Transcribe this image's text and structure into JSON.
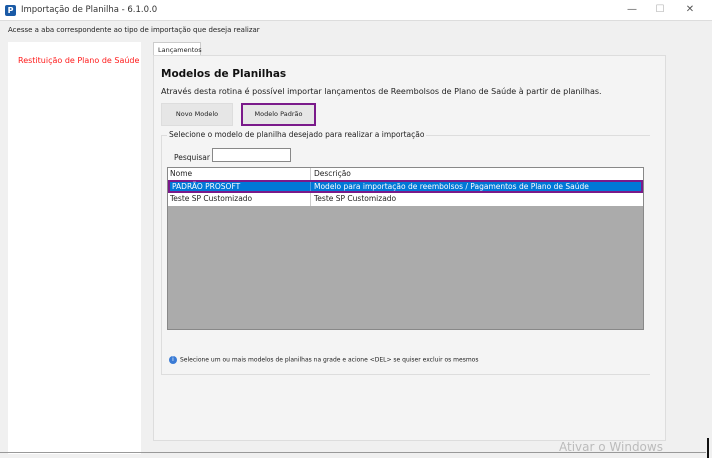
{
  "window": {
    "title": "Importação de Planilha - 6.1.0.0",
    "app_icon": "P",
    "minimize": "—",
    "maximize": "☐",
    "close": "✕"
  },
  "hint": "Acesse a aba correspondente ao tipo de importação que deseja realizar",
  "sidebar": {
    "items": [
      {
        "label": "Restituição de Plano de Saúde",
        "color": "#ff1a1a"
      }
    ]
  },
  "tabs": [
    {
      "label": "Lançamentos"
    }
  ],
  "main": {
    "title": "Modelos de Planilhas",
    "description": "Através desta rotina é possível importar lançamentos de Reembolsos de Plano de Saúde à partir de planilhas.",
    "buttons": {
      "new_model": "Novo Modelo",
      "default_model": "Modelo Padrão"
    },
    "group_label": "Selecione o modelo de planilha desejado para realizar a importação",
    "search_label": "Pesquisar",
    "search_value": "",
    "grid": {
      "columns": [
        "Nome",
        "Descrição"
      ],
      "rows": [
        {
          "nome": "PADRÃO PROSOFT",
          "descricao": "Modelo para importação de reembolsos / Pagamentos de Plano de Saúde",
          "selected": true
        },
        {
          "nome": "Teste SP Customizado",
          "descricao": "Teste SP Customizado",
          "selected": false
        }
      ]
    },
    "info_icon": "i",
    "info": "Selecione um ou mais modelos de planilhas na grade e acione <DEL> se quiser excluir os mesmos"
  },
  "watermark": "Ativar o Windows",
  "colors": {
    "selection": "#0078d7",
    "highlight_border": "#7a1a8a"
  }
}
